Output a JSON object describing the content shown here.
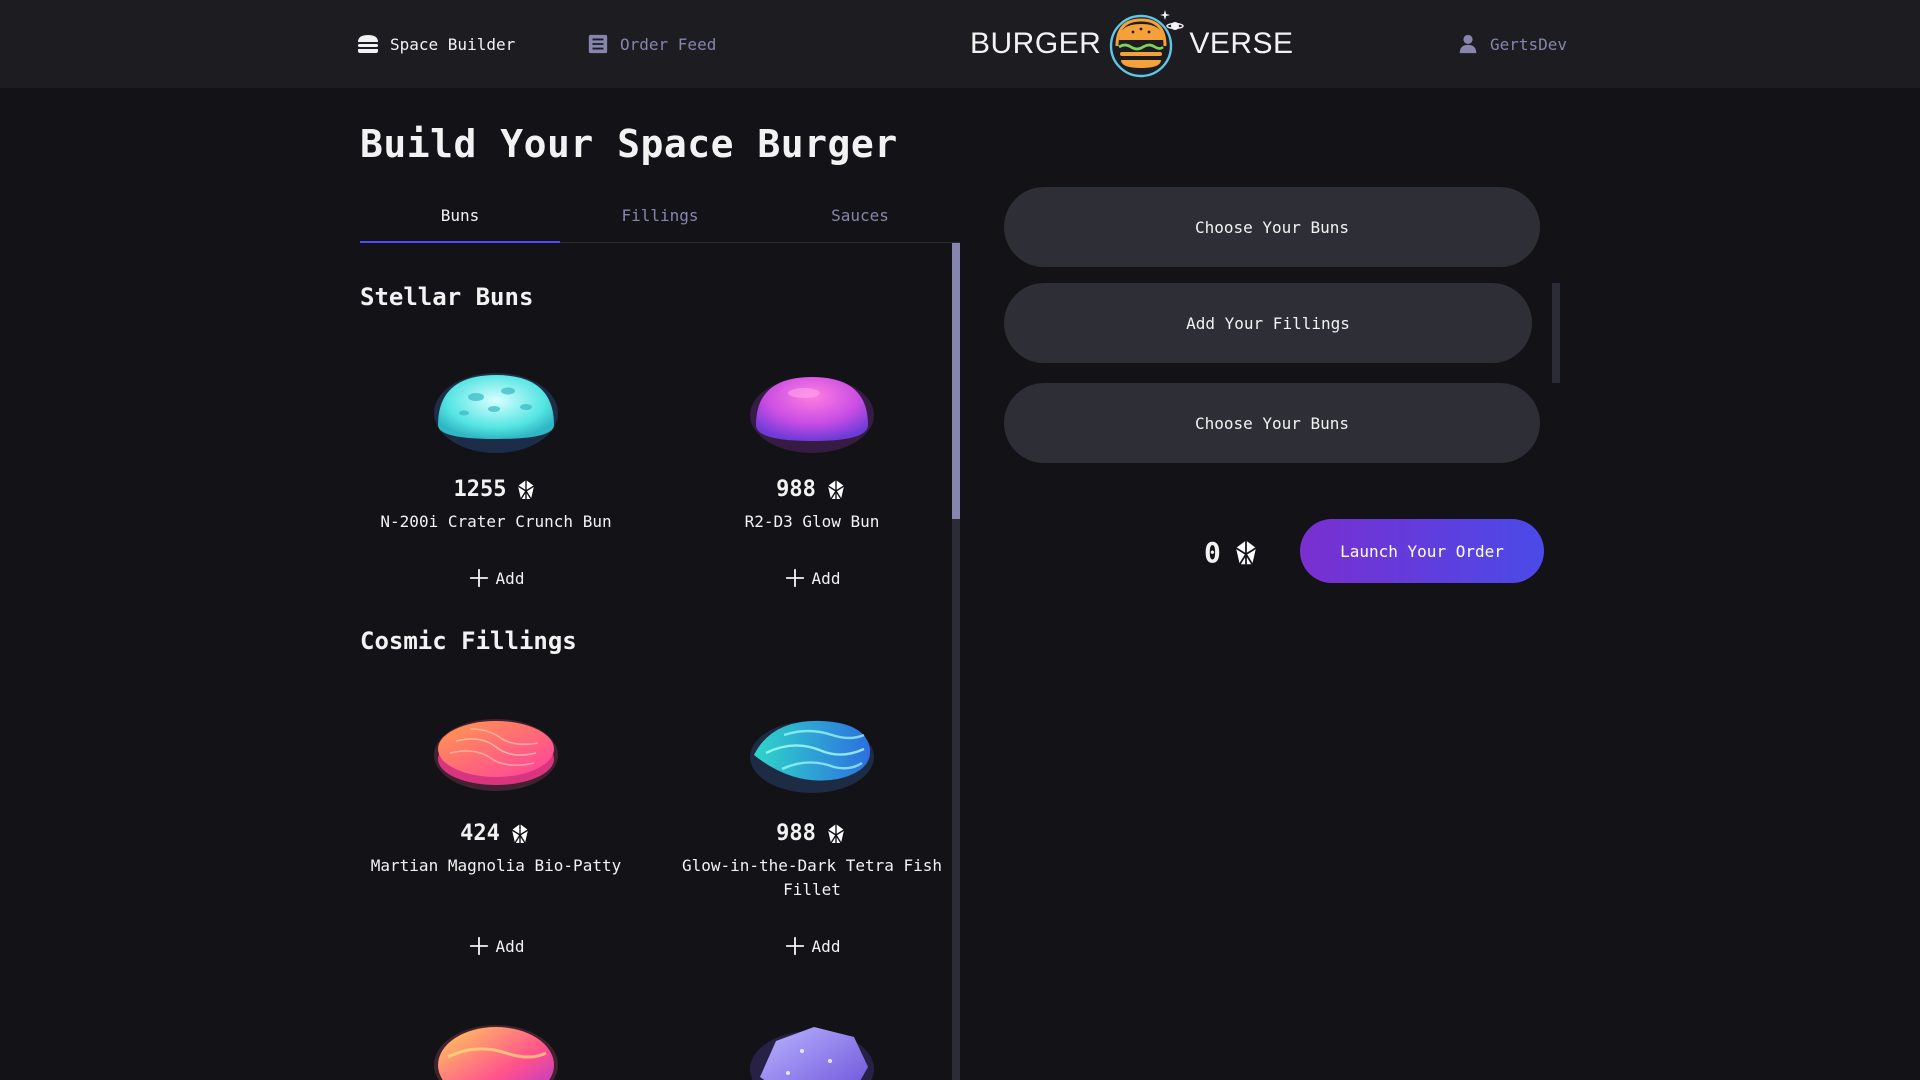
{
  "header": {
    "builder_label": "Space Builder",
    "feed_label": "Order Feed",
    "logo_left": "BURGER",
    "logo_right": "VERSE",
    "profile_label": "GertsDev"
  },
  "page": {
    "title": "Build Your Space Burger"
  },
  "tabs": [
    {
      "label": "Buns",
      "active": true
    },
    {
      "label": "Fillings",
      "active": false
    },
    {
      "label": "Sauces",
      "active": false
    }
  ],
  "sections": [
    {
      "title": "Stellar Buns",
      "items": [
        {
          "price": "1255",
          "name": "N-200i Crater Crunch Bun",
          "add_label": "Add"
        },
        {
          "price": "988",
          "name": "R2-D3 Glow Bun",
          "add_label": "Add"
        }
      ]
    },
    {
      "title": "Cosmic Fillings",
      "items": [
        {
          "price": "424",
          "name": "Martian Magnolia Bio-Patty",
          "add_label": "Add"
        },
        {
          "price": "988",
          "name": "Glow-in-the-Dark Tetra Fish Fillet",
          "add_label": "Add"
        }
      ]
    }
  ],
  "constructor": {
    "top_bun_label": "Choose Your Buns",
    "fillings_label": "Add Your Fillings",
    "bottom_bun_label": "Choose Your Buns",
    "total": "0",
    "submit_label": "Launch Your Order"
  },
  "icons": {
    "currency": "crystal-currency-icon",
    "builder": "burger-icon",
    "feed": "list-icon",
    "profile": "user-icon",
    "add": "plus-icon"
  },
  "colors": {
    "background": "#131317",
    "header": "#1c1c21",
    "accent": "#4c4cff",
    "muted": "#8585ad",
    "button_gradient_start": "#7a2fd0",
    "button_gradient_end": "#4a4ae8"
  }
}
